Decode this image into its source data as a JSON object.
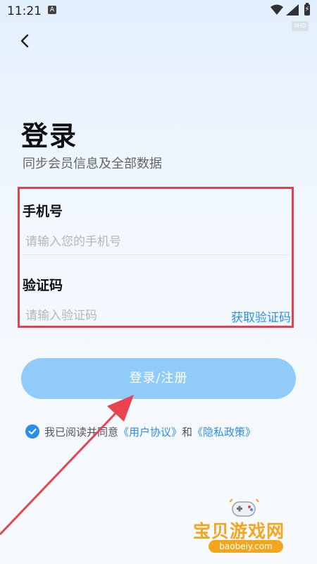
{
  "status_bar": {
    "time": "11:21",
    "badge": "A"
  },
  "mini_badge": "6HD",
  "header": {
    "title": "登录",
    "subtitle": "同步会员信息及全部数据"
  },
  "form": {
    "phone": {
      "label": "手机号",
      "placeholder": "请输入您的手机号",
      "value": ""
    },
    "code": {
      "label": "验证码",
      "placeholder": "请输入验证码",
      "value": "",
      "get_code_label": "获取验证码"
    }
  },
  "login_button": {
    "label": "登录/注册"
  },
  "agreement": {
    "prefix": "我已阅读并同意",
    "user_agreement": "《用户协议》",
    "conjunction": "和",
    "privacy_policy": "《隐私政策》",
    "checked": true
  },
  "watermark": {
    "name": "宝贝游戏网",
    "url": "baobeiy.com"
  },
  "colors": {
    "accent": "#2b8fea",
    "button_bg": "#90cbfa",
    "highlight_red": "#e04250",
    "watermark_orange": "#f3a51d",
    "background_top": "#e3f0fd"
  }
}
